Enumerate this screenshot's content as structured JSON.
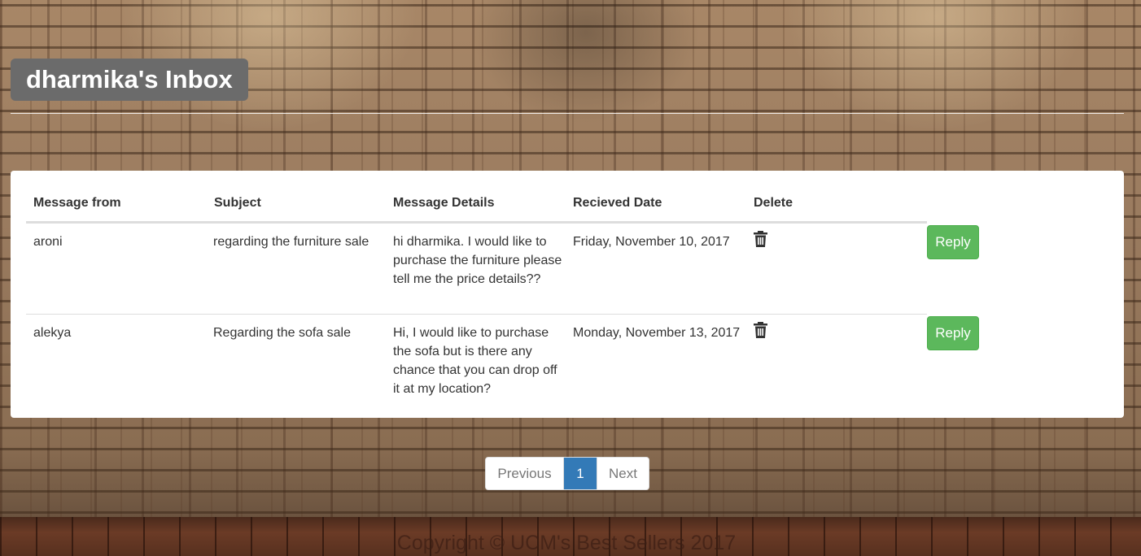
{
  "header": {
    "title": "dharmika's Inbox"
  },
  "table": {
    "columns": [
      "Message from",
      "Subject",
      "Message Details",
      "Recieved Date",
      "Delete"
    ],
    "rows": [
      {
        "from": "aroni",
        "subject": "regarding the furniture sale",
        "details": "hi dharmika. I would like to purchase the furniture please tell me the price details??",
        "date": "Friday, November 10, 2017",
        "delete_icon": "trash-icon",
        "reply_label": "Reply"
      },
      {
        "from": "alekya",
        "subject": "Regarding the sofa sale",
        "details": "Hi, I would like to purchase the sofa but is there any chance that you can drop off it at my location?",
        "date": "Monday, November 13, 2017",
        "delete_icon": "trash-icon",
        "reply_label": "Reply"
      }
    ]
  },
  "pagination": {
    "previous_label": "Previous",
    "current_page": "1",
    "next_label": "Next"
  },
  "footer": {
    "copyright": "Copyright © UCM's Best Sellers 2017"
  },
  "colors": {
    "reply_button": "#5cb85c",
    "active_page": "#337ab7",
    "title_box": "#6b6b6b"
  }
}
